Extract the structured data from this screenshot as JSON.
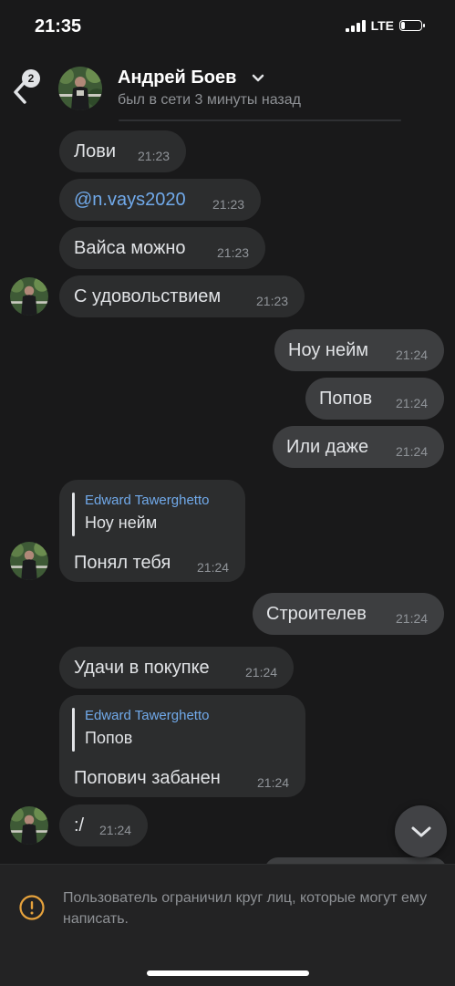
{
  "status_bar": {
    "time": "21:35",
    "network": "LTE",
    "battery_level": 0.2
  },
  "header": {
    "unread_count": "2",
    "contact_name": "Андрей Боев",
    "contact_status": "был в сети 3 минуты назад"
  },
  "messages": [
    {
      "text": "Лови",
      "time": "21:23"
    },
    {
      "text": "@n.vays2020",
      "time": "21:23"
    },
    {
      "text": "Вайса можно",
      "time": "21:23"
    },
    {
      "text": "С удовольствием",
      "time": "21:23"
    },
    {
      "text": "Ноу нейм",
      "time": "21:24"
    },
    {
      "text": "Попов",
      "time": "21:24"
    },
    {
      "text": "Или даже",
      "time": "21:24"
    },
    {
      "reply_author": "Edward Tawerghetto",
      "reply_text": "Ноу нейм",
      "text": "Понял тебя",
      "time": "21:24"
    },
    {
      "text": "Строителев",
      "time": "21:24"
    },
    {
      "text": "Удачи в покупке",
      "time": "21:24"
    },
    {
      "reply_author": "Edward Tawerghetto",
      "reply_text": "Попов",
      "text": "Попович забанен",
      "time": "21:24"
    },
    {
      "text": ":/",
      "time": "21:24"
    }
  ],
  "footer": {
    "notice": "Пользователь ограничил круг лиц, которые могут ему написать."
  },
  "icons": {
    "back": "chevron-left-icon",
    "warning": "warning-circle-icon",
    "scroll_down": "chevron-down-icon"
  },
  "colors": {
    "background": "#19191a",
    "incoming": "#2c2d2e",
    "outgoing": "#3d3e40",
    "link": "#71aaeb",
    "warning": "#e6a23c"
  }
}
